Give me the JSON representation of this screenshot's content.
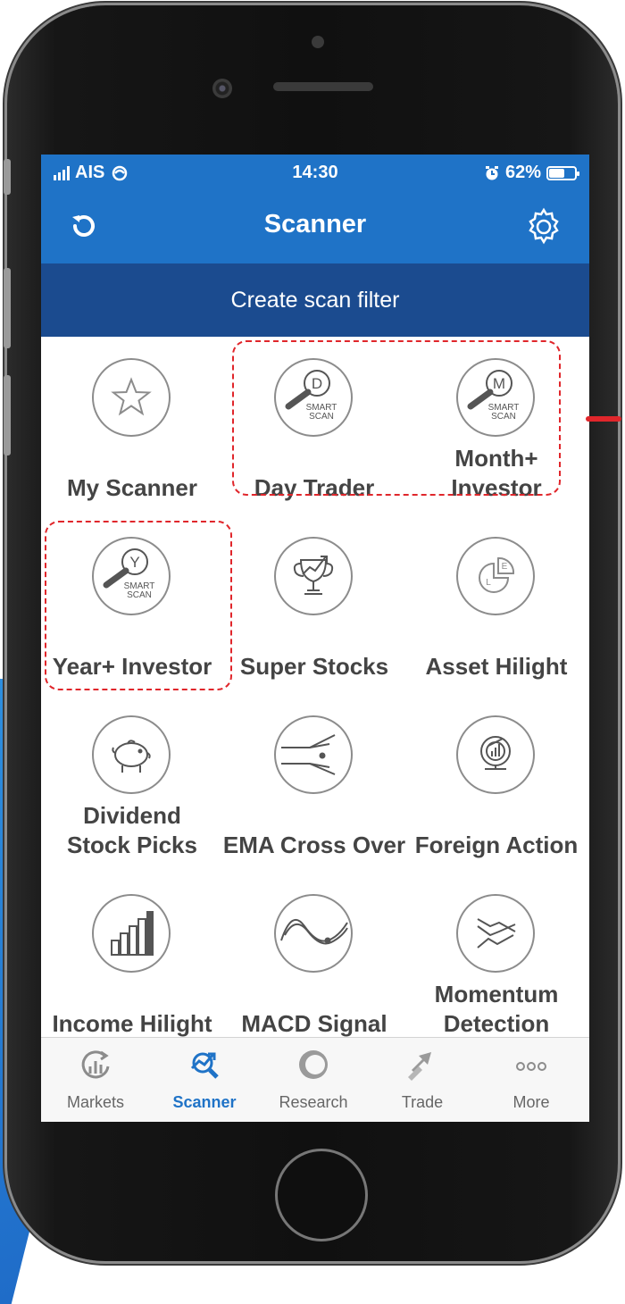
{
  "status_bar": {
    "carrier": "AIS",
    "time": "14:30",
    "battery": "62%",
    "battery_level": 0.62
  },
  "header": {
    "title": "Scanner"
  },
  "create_bar": {
    "label": "Create scan filter"
  },
  "grid": [
    {
      "label": "My Scanner",
      "icon": "star-icon"
    },
    {
      "label": "Day Trader",
      "icon": "smart-scan-d-icon",
      "badge_letter": "D",
      "badge_text": [
        "SMART",
        "SCAN"
      ]
    },
    {
      "label": "Month+ Investor",
      "icon": "smart-scan-m-icon",
      "badge_letter": "M",
      "badge_text": [
        "SMART",
        "SCAN"
      ]
    },
    {
      "label": "Year+ Investor",
      "icon": "smart-scan-y-icon",
      "badge_letter": "Y",
      "badge_text": [
        "SMART",
        "SCAN"
      ]
    },
    {
      "label": "Super Stocks",
      "icon": "trophy-icon"
    },
    {
      "label": "Asset Hilight",
      "icon": "pie-chart-icon",
      "badge_letter": "E",
      "axis_letter": "L"
    },
    {
      "label": "Dividend Stock Picks",
      "icon": "piggy-bank-icon"
    },
    {
      "label": "EMA Cross Over",
      "icon": "cross-over-icon"
    },
    {
      "label": "Foreign Action",
      "icon": "globe-chart-icon"
    },
    {
      "label": "Income Hilight",
      "icon": "bar-chart-icon"
    },
    {
      "label": "MACD Signal",
      "icon": "wave-icon"
    },
    {
      "label": "Momentum Detection",
      "icon": "momentum-icon"
    }
  ],
  "tabs": [
    {
      "label": "Markets",
      "icon": "markets-icon",
      "active": false
    },
    {
      "label": "Scanner",
      "icon": "scanner-icon",
      "active": true
    },
    {
      "label": "Research",
      "icon": "research-icon",
      "active": false
    },
    {
      "label": "Trade",
      "icon": "trade-icon",
      "active": false
    },
    {
      "label": "More",
      "icon": "more-icon",
      "active": false
    }
  ],
  "colors": {
    "primary": "#1f73c7",
    "banner": "#1b4b8f",
    "highlight": "#e0262b",
    "icon_gray": "#8c8c8c"
  }
}
